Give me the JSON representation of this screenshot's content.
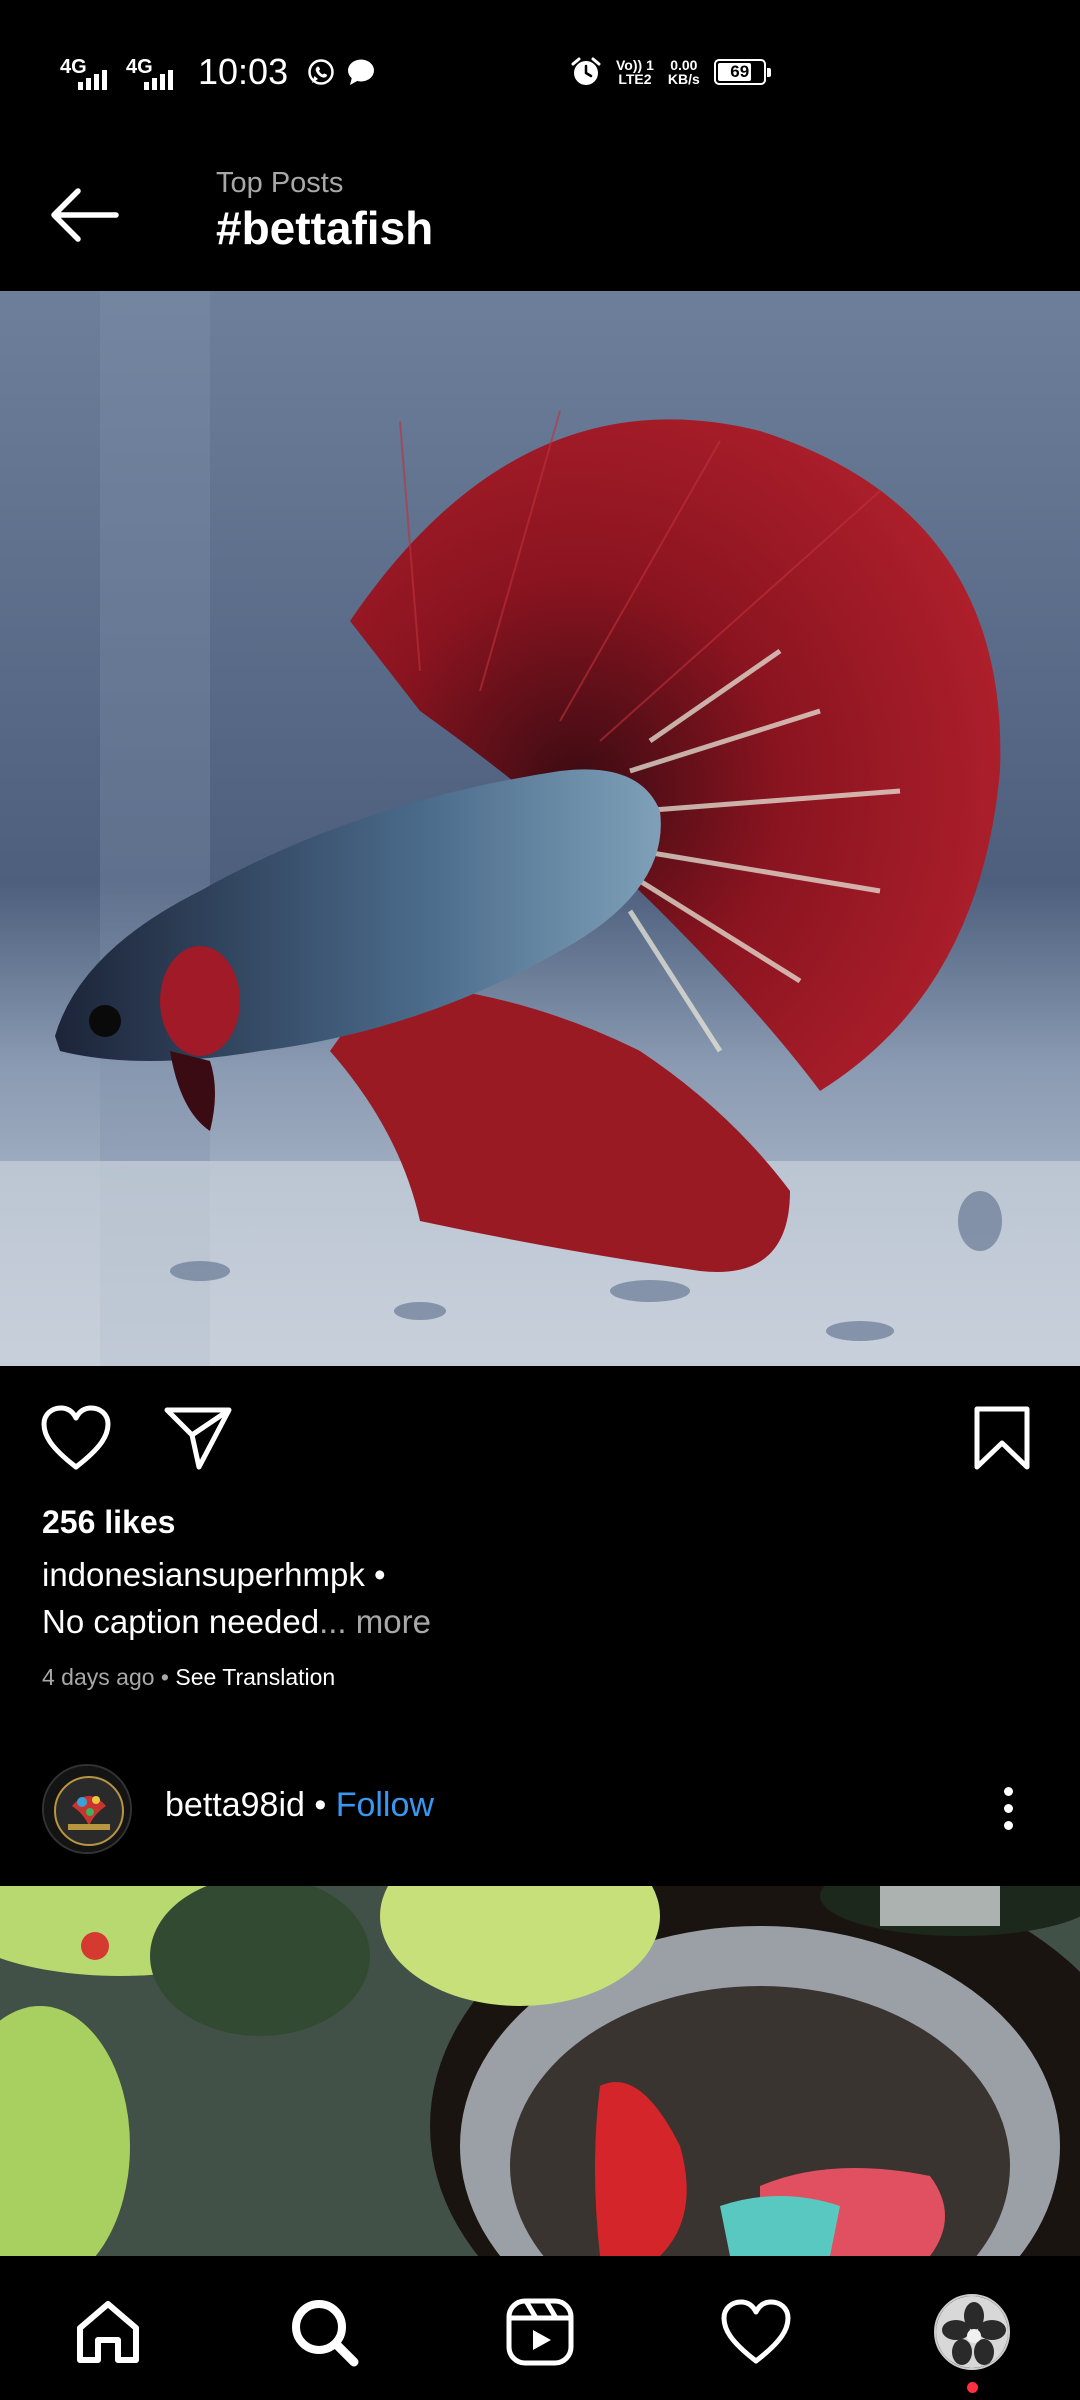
{
  "status_bar": {
    "sim1_network": "4G",
    "sim2_network": "4G",
    "time": "10:03",
    "volte_line1": "Vo)) 1",
    "volte_line2": "LTE2",
    "speed_value": "0.00",
    "speed_unit": "KB/s",
    "battery_level": "69",
    "icons": [
      "whatsapp-icon",
      "message-icon",
      "alarm-icon"
    ]
  },
  "header": {
    "subtitle": "Top Posts",
    "title": "#bettafish",
    "back_icon": "back-arrow-icon"
  },
  "post1": {
    "image_description_icon": "betta-fish-photo",
    "likes": "256 likes",
    "username": "indonesiansuperhmpk •",
    "caption": "No caption needed",
    "caption_more": "... more",
    "time_ago": "4 days ago",
    "meta_sep": " • ",
    "see_translation": "See Translation",
    "actions": [
      "heart-icon",
      "share-icon",
      "bookmark-icon"
    ]
  },
  "post2": {
    "username": "betta98id",
    "separator": " • ",
    "follow_label": "Follow",
    "menu_icon": "more-vertical-icon"
  },
  "bottom_nav": {
    "items": [
      "home-icon",
      "search-icon",
      "reels-icon",
      "activity-heart-icon",
      "profile-avatar"
    ],
    "notification_dot_color": "#ff3040"
  },
  "colors": {
    "background": "#000000",
    "text": "#ffffff",
    "secondary_text": "#a8a8a8",
    "link_blue": "#3897f0"
  }
}
